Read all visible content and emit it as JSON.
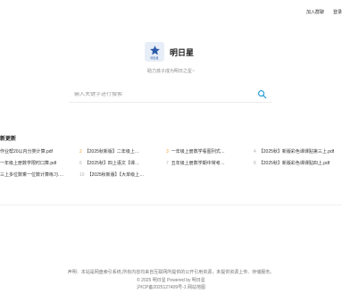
{
  "topnav": {
    "join": "加入群聊",
    "login": "登录"
  },
  "brand": {
    "logo_text": "明日星",
    "name": "明日星",
    "slogan": "助力孩子成为明日之星~"
  },
  "search": {
    "placeholder": "输入关键字进行搜索"
  },
  "latest": {
    "heading": "新更新",
    "rows": [
      [
        {
          "num": "",
          "title": "作业帮20以内分类计算.pdf"
        },
        {
          "num": "2",
          "title": "【2025秋新版】二年级上册数学易..."
        },
        {
          "num": "3",
          "title": "一年级上册数学看图列式专项训练..."
        },
        {
          "num": "4",
          "title": "【2025秋】新版彩色课课贴第三上.pdf"
        }
      ],
      [
        {
          "num": "",
          "title": "一年级上册数学限时口算.pdf"
        },
        {
          "num": "6",
          "title": "【2025秋】四上语文【课课贴】生..."
        },
        {
          "num": "7",
          "title": "五年级上册数学期中常考小数难点..."
        },
        {
          "num": "8",
          "title": "【2025秋】新版彩色课课贴四上.pdf"
        }
      ],
      [
        {
          "num": "",
          "title": "三上多位数乘一位数计算练习.pdf"
        },
        {
          "num": "10",
          "title": "【2025秋新版】【大单级上册语..."
        }
      ]
    ]
  },
  "footer": {
    "disclaimer": "声明：本站是网盘索引系统,所有内容均来自互联网所提供的公开引用资源，未提供资源上传、存储服务。",
    "copyright": "© 2025 明日星 Powered by 明日星",
    "icp": "沪ICP备2025127409号-1 网站地图"
  }
}
